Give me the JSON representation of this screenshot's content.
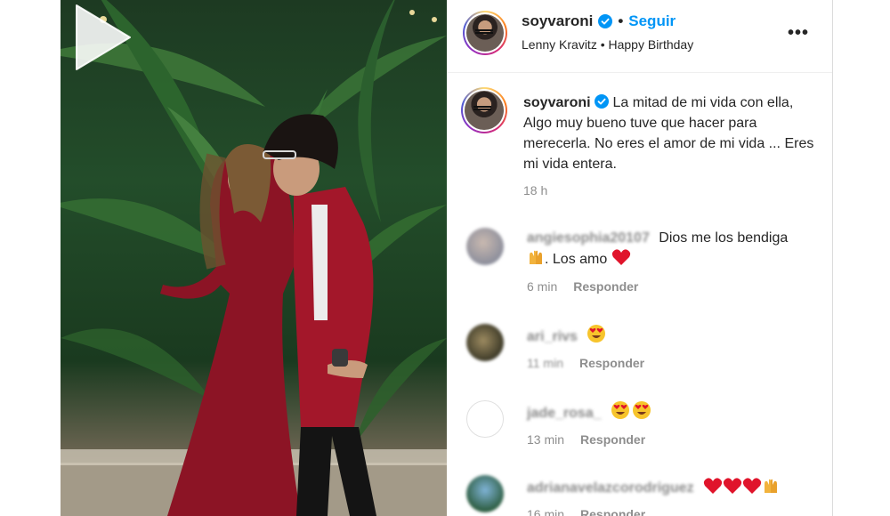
{
  "post": {
    "username": "soyvaroni",
    "separator": "•",
    "follow_label": "Seguir",
    "audio_subtitle": "Lenny Kravitz • Happy Birthday",
    "more_label": "•••"
  },
  "caption": {
    "username": "soyvaroni",
    "text": "La mitad de mi vida con ella, Algo muy bueno tuve que hacer para merecerla. No eres el amor de mi vida ... Eres mi vida entera.",
    "time": "18 h"
  },
  "comments": [
    {
      "username": "angiesophia20107",
      "text": "Dios me los bendiga",
      "text2": ". Los amo",
      "time": "6 min",
      "reply": "Responder"
    },
    {
      "username": "ari_rivs",
      "text": "",
      "time": "11 min",
      "reply": "Responder"
    },
    {
      "username": "jade_rosa_",
      "text": "",
      "time": "13 min",
      "reply": "Responder"
    },
    {
      "username": "adrianavelazcorodriguez",
      "text": "",
      "time": "16 min",
      "reply": "Responder"
    }
  ],
  "colors": {
    "accent": "#0095f6",
    "verified": "#0095f6",
    "heart": "#e0142b",
    "muted": "#8e8e8e"
  },
  "icons": [
    "verified-badge-icon",
    "more-options-icon",
    "play-icon",
    "heart-emoji-icon",
    "heart-eyes-emoji-icon",
    "raised-hands-emoji-icon"
  ]
}
